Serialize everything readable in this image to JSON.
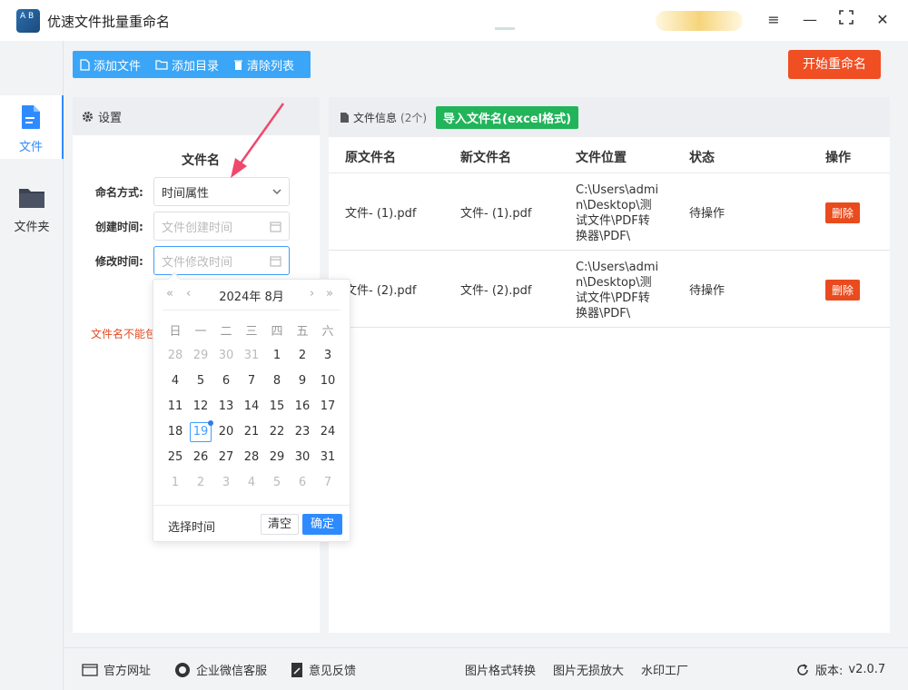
{
  "app": {
    "logo_text": "A B",
    "title": "优速文件批量重命名"
  },
  "window_controls": {
    "menu": "≡",
    "minimize": "—",
    "maximize": "⛶",
    "close": "✕"
  },
  "nav": [
    {
      "label": "文件",
      "icon": "file-icon",
      "active": true
    },
    {
      "label": "文件夹",
      "icon": "folder-icon",
      "active": false
    }
  ],
  "toolbar": {
    "add_file": "添加文件",
    "add_dir": "添加目录",
    "clear_list": "清除列表"
  },
  "start_button": "开始重命名",
  "settings": {
    "header": "设置",
    "section_title": "文件名",
    "naming_label": "命名方式:",
    "naming_value": "时间属性",
    "created_label": "创建时间:",
    "created_placeholder": "文件创建时间",
    "modified_label": "修改时间:",
    "modified_placeholder": "文件修改时间",
    "warning": "文件名不能包"
  },
  "file_info": {
    "header": "文件信息",
    "count": "(2个)",
    "import_button": "导入文件名(excel格式)",
    "columns": [
      "原文件名",
      "新文件名",
      "文件位置",
      "状态",
      "操作"
    ],
    "rows": [
      {
        "original": "文件- (1).pdf",
        "new": "文件- (1).pdf",
        "location": "C:\\Users\\admin\\Desktop\\测试文件\\PDF转换器\\PDF\\",
        "status": "待操作",
        "action": "删除"
      },
      {
        "original": "文件- (2).pdf",
        "new": "文件- (2).pdf",
        "location": "C:\\Users\\admin\\Desktop\\测试文件\\PDF转换器\\PDF\\",
        "status": "待操作",
        "action": "删除"
      }
    ]
  },
  "datepicker": {
    "title": "2024年 8月",
    "prev_year": "«",
    "prev_month": "‹",
    "next_month": "›",
    "next_year": "»",
    "weekdays": [
      "日",
      "一",
      "二",
      "三",
      "四",
      "五",
      "六"
    ],
    "days": [
      {
        "d": "28",
        "other": true
      },
      {
        "d": "29",
        "other": true
      },
      {
        "d": "30",
        "other": true
      },
      {
        "d": "31",
        "other": true
      },
      {
        "d": "1"
      },
      {
        "d": "2"
      },
      {
        "d": "3"
      },
      {
        "d": "4"
      },
      {
        "d": "5"
      },
      {
        "d": "6"
      },
      {
        "d": "7"
      },
      {
        "d": "8"
      },
      {
        "d": "9"
      },
      {
        "d": "10"
      },
      {
        "d": "11"
      },
      {
        "d": "12"
      },
      {
        "d": "13"
      },
      {
        "d": "14"
      },
      {
        "d": "15"
      },
      {
        "d": "16"
      },
      {
        "d": "17"
      },
      {
        "d": "18"
      },
      {
        "d": "19",
        "today": true
      },
      {
        "d": "20"
      },
      {
        "d": "21"
      },
      {
        "d": "22"
      },
      {
        "d": "23"
      },
      {
        "d": "24"
      },
      {
        "d": "25"
      },
      {
        "d": "26"
      },
      {
        "d": "27"
      },
      {
        "d": "28"
      },
      {
        "d": "29"
      },
      {
        "d": "30"
      },
      {
        "d": "31"
      },
      {
        "d": "1",
        "other": true
      },
      {
        "d": "2",
        "other": true
      },
      {
        "d": "3",
        "other": true
      },
      {
        "d": "4",
        "other": true
      },
      {
        "d": "5",
        "other": true
      },
      {
        "d": "6",
        "other": true
      },
      {
        "d": "7",
        "other": true
      }
    ],
    "select_time": "选择时间",
    "clear": "清空",
    "confirm": "确定"
  },
  "footer": {
    "website": "官方网址",
    "wechat": "企业微信客服",
    "feedback": "意见反馈",
    "img_convert": "图片格式转换",
    "img_enlarge": "图片无损放大",
    "watermark": "水印工厂",
    "version_label": "版本:",
    "version": "v2.0.7"
  },
  "colors": {
    "accent": "#2e8bff",
    "toolbar": "#3ba6f7",
    "start": "#f04e23",
    "import": "#21b45a",
    "delete": "#e94b1e",
    "annotation": "#f0486c"
  }
}
